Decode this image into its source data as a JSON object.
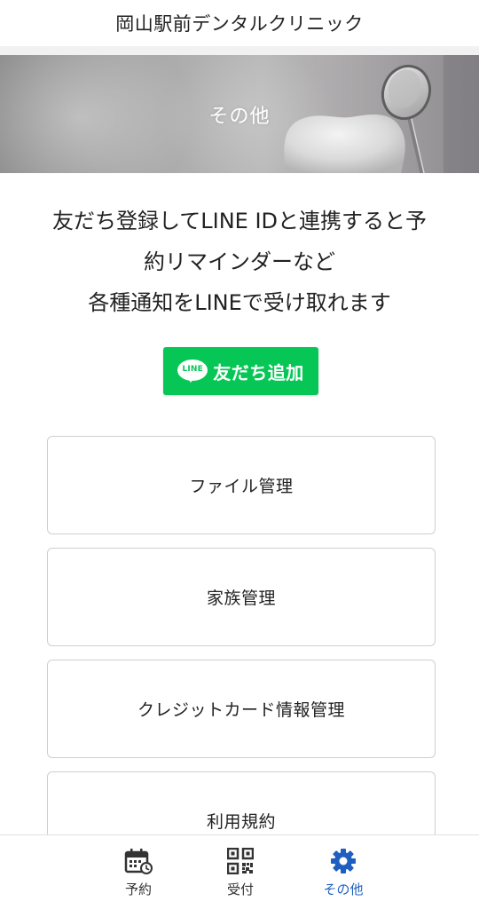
{
  "header": {
    "title": "岡山駅前デンタルクリニック"
  },
  "hero": {
    "title": "その他"
  },
  "intro": {
    "lines": [
      "友だち登録してLINE IDと連携すると予",
      "約リマインダーなど",
      "各種通知をLINEで受け取れます"
    ]
  },
  "line_button": {
    "logo_text": "LINE",
    "label": "友だち追加",
    "color": "#06c755"
  },
  "menu": {
    "items": [
      {
        "label": "ファイル管理"
      },
      {
        "label": "家族管理"
      },
      {
        "label": "クレジットカード情報管理"
      },
      {
        "label": "利用規約"
      }
    ]
  },
  "bottom_nav": {
    "items": [
      {
        "label": "予約",
        "icon": "calendar-clock-icon"
      },
      {
        "label": "受付",
        "icon": "qr-code-icon"
      },
      {
        "label": "その他",
        "icon": "gear-icon",
        "active": true
      }
    ],
    "active_color": "#1f5fbf"
  }
}
